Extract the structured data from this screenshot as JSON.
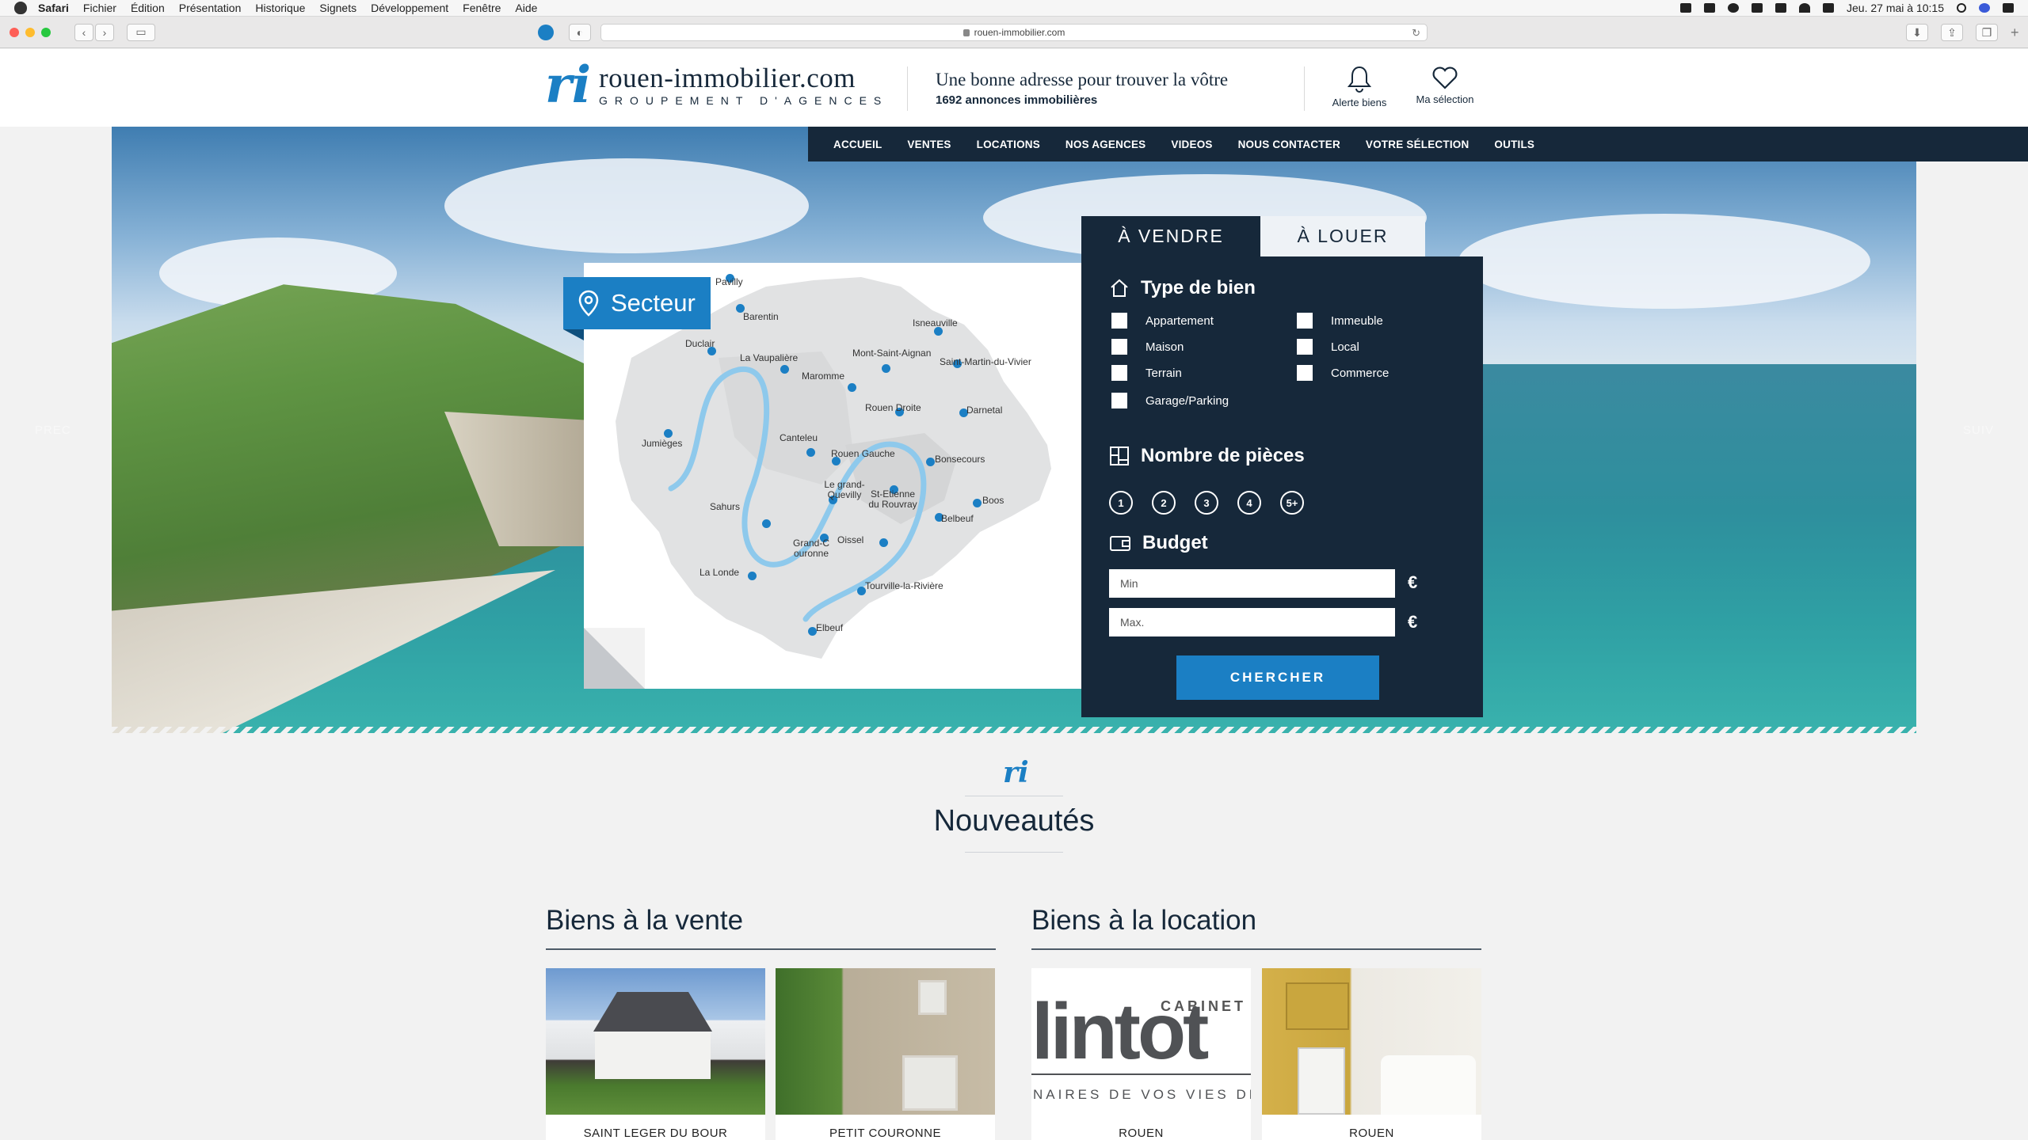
{
  "menubar": {
    "app": "Safari",
    "items": [
      "Fichier",
      "Édition",
      "Présentation",
      "Historique",
      "Signets",
      "Développement",
      "Fenêtre",
      "Aide"
    ],
    "clock": "Jeu. 27 mai à 10:15"
  },
  "browser": {
    "url": "rouen-immobilier.com"
  },
  "header": {
    "logo_name": "rouen-immobilier.com",
    "logo_sub": "GROUPEMENT D'AGENCES",
    "tagline": "Une bonne adresse pour trouver la vôtre",
    "count": "1692 annonces immobilières",
    "alert_label": "Alerte biens",
    "selection_label": "Ma sélection"
  },
  "nav": [
    "ACCUEIL",
    "VENTES",
    "LOCATIONS",
    "NOS AGENCES",
    "VIDEOS",
    "NOUS CONTACTER",
    "VOTRE SÉLECTION",
    "OUTILS"
  ],
  "hero": {
    "prev": "PREC",
    "next": "SUIV"
  },
  "map": {
    "title": "Secteur",
    "places": [
      "Pavilly",
      "Barentin",
      "Duclair",
      "La Vaupalière",
      "Isneauville",
      "Mont-Saint-Aignan",
      "Maromme",
      "Saint-Martin-du-Vivier",
      "Darnetal",
      "Rouen Droite",
      "Jumièges",
      "Canteleu",
      "Rouen Gauche",
      "Bonsecours",
      "Le grand-Quevilly",
      "St-Etienne du Rouvray",
      "Boos",
      "Sahurs",
      "Belbeuf",
      "Grand-Couronne",
      "Oissel",
      "La Londe",
      "Tourville-la-Rivière",
      "Elbeuf"
    ]
  },
  "search": {
    "tab_buy": "À VENDRE",
    "tab_rent": "À LOUER",
    "type_title": "Type de bien",
    "types_left": [
      "Appartement",
      "Maison",
      "Terrain",
      "Garage/Parking"
    ],
    "types_right": [
      "Immeuble",
      "Local",
      "Commerce"
    ],
    "rooms_title": "Nombre de pièces",
    "rooms": [
      "1",
      "2",
      "3",
      "4",
      "5+"
    ],
    "budget_title": "Budget",
    "min_placeholder": "Min",
    "max_placeholder": "Max.",
    "currency": "€",
    "button": "CHERCHER"
  },
  "news": {
    "title": "Nouveautés",
    "sale_title": "Biens à la vente",
    "rent_title": "Biens à la location",
    "cards": [
      "SAINT LEGER DU BOUR",
      "PETIT COURONNE",
      "ROUEN",
      "ROUEN"
    ],
    "lintot_small": "CABINET",
    "lintot_big": "lintot",
    "lintot_line": "NAIRES DE VOS VIES DEPUIS"
  },
  "colors": {
    "navy": "#16283a",
    "brand_blue": "#1b7fc4"
  }
}
